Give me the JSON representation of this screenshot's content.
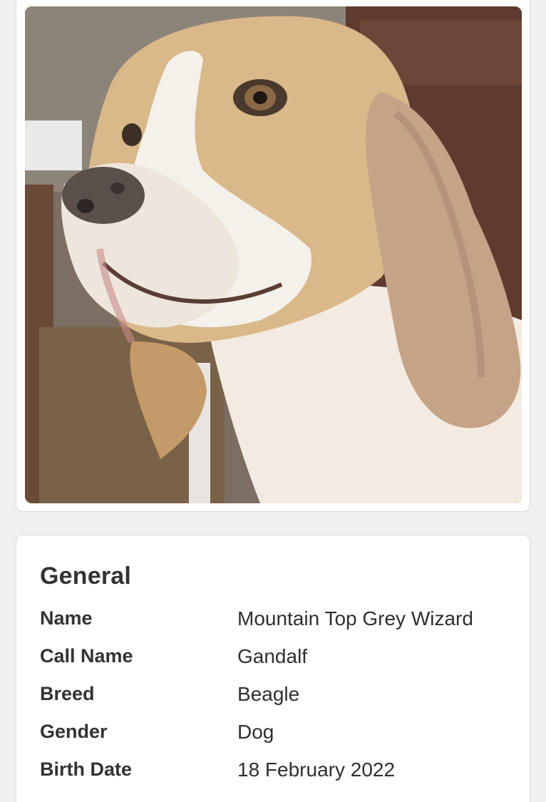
{
  "photo": {
    "subject": "beagle-portrait"
  },
  "general": {
    "title": "General",
    "rows": [
      {
        "label": "Name",
        "value": "Mountain Top Grey Wizard"
      },
      {
        "label": "Call Name",
        "value": "Gandalf"
      },
      {
        "label": "Breed",
        "value": "Beagle"
      },
      {
        "label": "Gender",
        "value": "Dog"
      },
      {
        "label": "Birth Date",
        "value": "18 February 2022"
      }
    ]
  }
}
